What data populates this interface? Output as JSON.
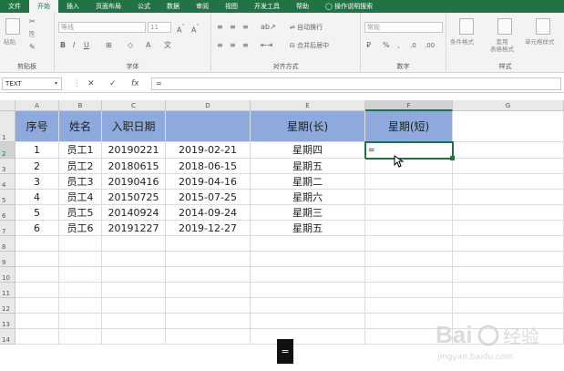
{
  "menu": {
    "items": [
      "文件",
      "开始",
      "插入",
      "页面布局",
      "公式",
      "数据",
      "审阅",
      "视图",
      "开发工具",
      "帮助",
      "操作说明搜索"
    ],
    "active_index": 1
  },
  "ribbon": {
    "clipboard": {
      "paste_label": "粘贴",
      "group_label": "剪贴板"
    },
    "font": {
      "font_name": "等线",
      "font_size": "11",
      "bold": "B",
      "italic": "I",
      "underline": "U",
      "group_label": "字体"
    },
    "alignment": {
      "wrap_text": "自动换行",
      "merge_center": "合并后居中",
      "group_label": "对齐方式"
    },
    "number": {
      "format": "常规",
      "group_label": "数字"
    },
    "styles": {
      "conditional_format": "条件格式",
      "table_format": "套用\n表格格式",
      "cell_styles": "单元格样式",
      "group_label": "样式"
    }
  },
  "formula_bar": {
    "name_box": "TEXT",
    "cancel": "✕",
    "enter": "✓",
    "fx": "fx",
    "content": "="
  },
  "sheet": {
    "columns": [
      "A",
      "B",
      "C",
      "D",
      "E",
      "F",
      "G"
    ],
    "rows": [
      "1",
      "2",
      "3",
      "4",
      "5",
      "6",
      "7",
      "8",
      "9",
      "10",
      "11",
      "12",
      "13",
      "14"
    ],
    "selected_column": "F",
    "selected_row": "2",
    "header": [
      "序号",
      "姓名",
      "入职日期",
      "",
      "星期(长)",
      "星期(短)"
    ],
    "data": [
      [
        "1",
        "员工1",
        "20190221",
        "2019-02-21",
        "星期四",
        "="
      ],
      [
        "2",
        "员工2",
        "20180615",
        "2018-06-15",
        "星期五",
        ""
      ],
      [
        "3",
        "员工3",
        "20190416",
        "2019-04-16",
        "星期二",
        ""
      ],
      [
        "4",
        "员工4",
        "20150725",
        "2015-07-25",
        "星期六",
        ""
      ],
      [
        "5",
        "员工5",
        "20140924",
        "2014-09-24",
        "星期三",
        ""
      ],
      [
        "6",
        "员工6",
        "20191227",
        "2019-12-27",
        "星期五",
        ""
      ]
    ]
  },
  "tooltip": {
    "text": "="
  },
  "watermark": {
    "brand": "Baidu 经验",
    "url": "jingyan.baidu.com"
  },
  "colors": {
    "accent": "#217346",
    "header_fill": "#8ea9db"
  }
}
